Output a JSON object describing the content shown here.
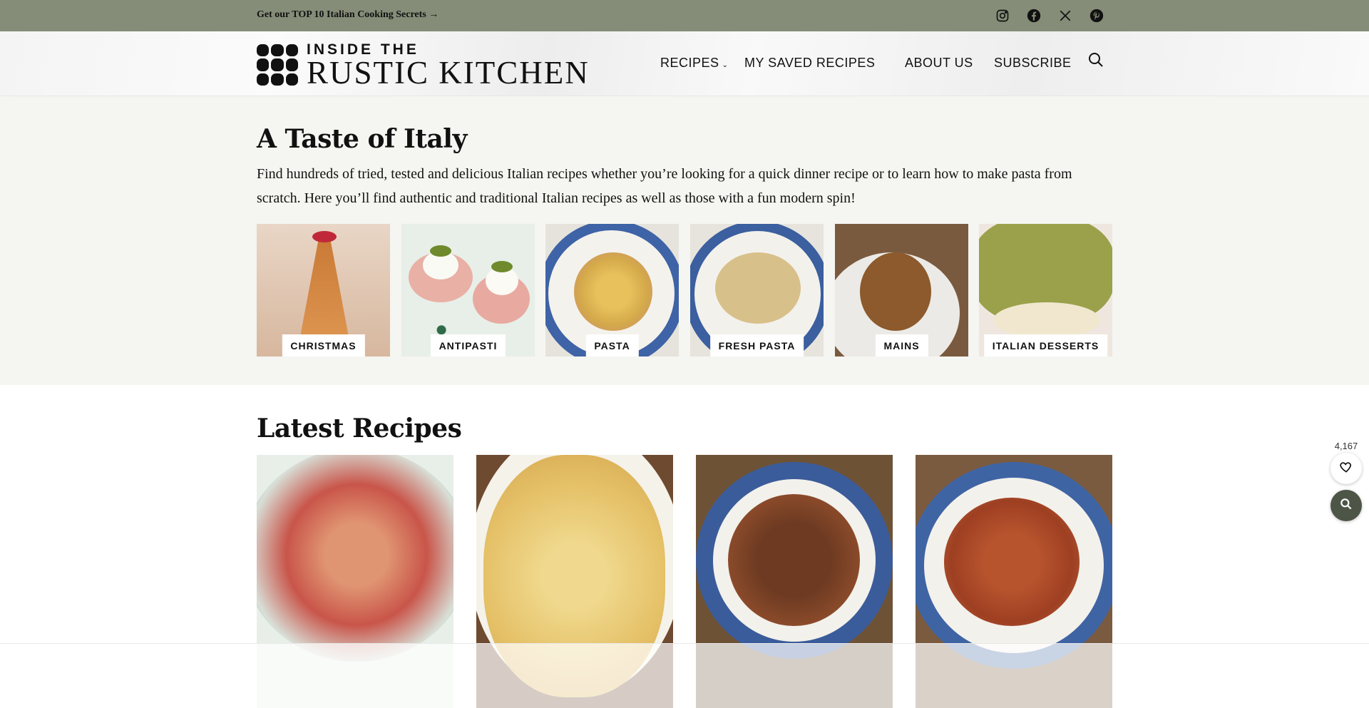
{
  "topbar": {
    "promo": "Get our TOP 10 Italian Cooking Secrets →",
    "social_icons": [
      "instagram-icon",
      "facebook-icon",
      "x-icon",
      "pinterest-icon"
    ],
    "bg_color": "#858d78"
  },
  "header": {
    "logo_top": "INSIDE THE",
    "logo_main": "RUSTIC KITCHEN",
    "nav": {
      "recipes": "RECIPES",
      "saved": " MY SAVED RECIPES",
      "about": "ABOUT US",
      "subscribe": "SUBSCRIBE"
    }
  },
  "taste": {
    "title": "A Taste of Italy",
    "intro": "Find hundreds of tried, tested and delicious Italian recipes whether you’re looking for a quick dinner recipe or to learn how to make pasta from scratch. Here you’ll find authentic and traditional Italian recipes as well as those with a fun modern spin!",
    "categories": [
      "CHRISTMAS",
      "ANTIPASTI",
      "PASTA",
      "FRESH PASTA",
      "MAINS",
      "ITALIAN DESSERTS"
    ]
  },
  "latest": {
    "title": "Latest Recipes"
  },
  "widgets": {
    "favorite_count": "4,167",
    "accent_color": "#4d5547"
  }
}
